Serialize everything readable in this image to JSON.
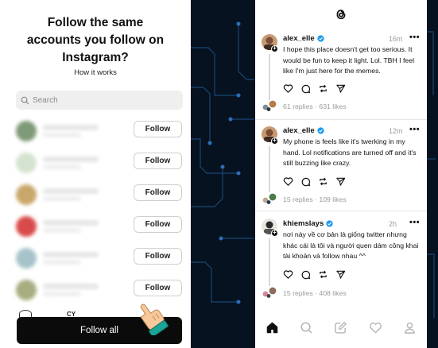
{
  "left_screen": {
    "title_lines": [
      "Follow the same",
      "accounts you follow on",
      "Instagram?"
    ],
    "how_it_works": "How it works",
    "search": {
      "placeholder": "Search"
    },
    "follow_label": "Follow",
    "rows": [
      {
        "avatar_color": "#7f9a78"
      },
      {
        "avatar_color": "#d4e3cf"
      },
      {
        "avatar_color": "#c9a76a"
      },
      {
        "avatar_color": "#d94b4b"
      },
      {
        "avatar_color": "#a6c3c9"
      },
      {
        "avatar_color": "#a7ad7f"
      }
    ],
    "bottom_partial_name": "CY",
    "follow_all_label": "Follow all"
  },
  "right_screen": {
    "logo_icon": "threads-logo-icon",
    "posts": [
      {
        "username": "alex_elle",
        "verified": true,
        "time": "16m",
        "text": "I hope this place doesn't get too serious. It would be fun to keep it light. Lol. TBH I feel like I'm just here for the memes.",
        "stats": "61 replies · 631 likes"
      },
      {
        "username": "alex_elle",
        "verified": true,
        "time": "12m",
        "text": "My phone is feels like it's twerking in my hand. Lol notifications are turned off and it's still buzzing like crazy.",
        "stats": "15 replies · 109 likes"
      },
      {
        "username": "khiemslays",
        "verified": true,
        "time": "2h",
        "text": "nơi này về cơ bản là giống twitter nhưng khác cái là tôi và người quen dám công khai tài khoản và follow nhau ^^",
        "stats": "15 replies · 408 likes"
      }
    ],
    "more_label": "•••",
    "nav_icons": [
      "home-icon",
      "search-icon",
      "compose-icon",
      "heart-icon",
      "profile-icon"
    ]
  },
  "colors": {
    "background": "#06121f",
    "circuit": "#1d4f86",
    "verified": "#1d9bf0",
    "follow_all_bg": "#0b0b0b",
    "cursor_cuff": "#1aa596",
    "cursor_hand": "#f6c89a"
  }
}
